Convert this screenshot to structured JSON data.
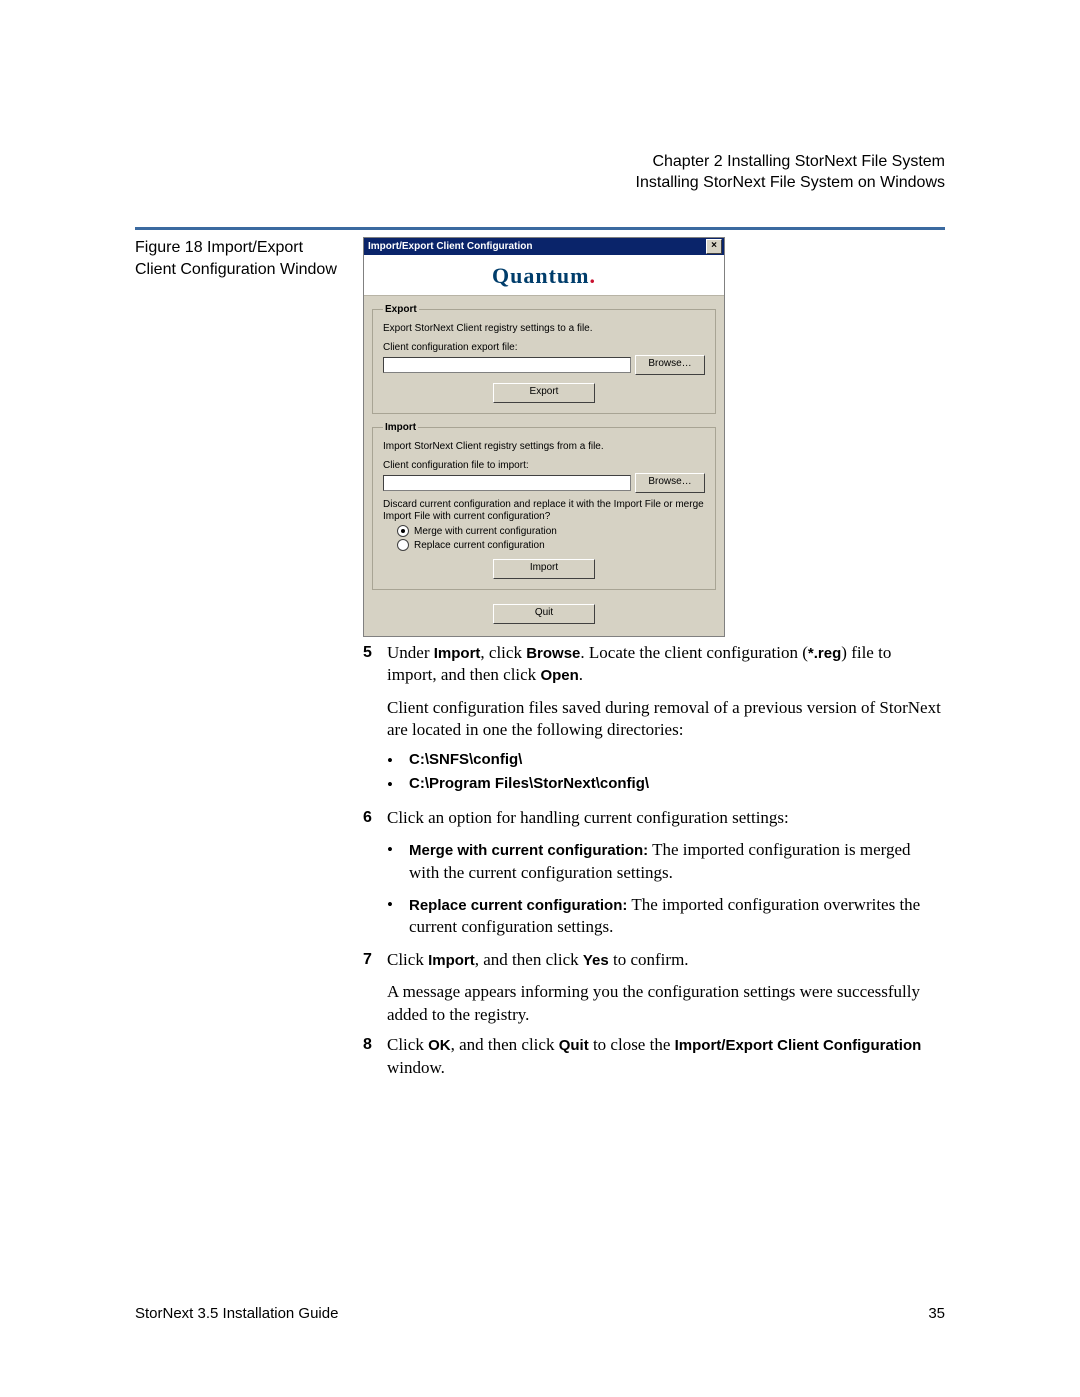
{
  "header": {
    "line1": "Chapter 2  Installing StorNext File System",
    "line2": "Installing StorNext File System on Windows"
  },
  "figure_caption": "Figure 18  Import/Export Client Configuration Window",
  "dialog": {
    "title": "Import/Export Client Configuration",
    "brand": "Quantum",
    "export": {
      "legend": "Export",
      "desc": "Export StorNext Client registry settings to a file.",
      "label": "Client configuration export file:",
      "browse": "Browse…",
      "action": "Export"
    },
    "import": {
      "legend": "Import",
      "desc": "Import StorNext Client registry settings from a file.",
      "label": "Client configuration file to import:",
      "browse": "Browse…",
      "question": "Discard current configuration and replace it with the Import File or merge Import File with current configuration?",
      "opt_merge": "Merge with current configuration",
      "opt_replace": "Replace current configuration",
      "action": "Import"
    },
    "quit": "Quit"
  },
  "steps": {
    "s5_pre": "Under ",
    "s5_b1": "Import",
    "s5_mid1": ", click ",
    "s5_b2": "Browse",
    "s5_mid2": ". Locate the client configuration (",
    "s5_b3": "*.reg",
    "s5_mid3": ") file to import, and then click ",
    "s5_b4": "Open",
    "s5_end": ".",
    "s5_para2": "Client configuration files saved during removal of a previous version of StorNext are located in one the following directories:",
    "path1": "C:\\SNFS\\config\\",
    "path2": "C:\\Program Files\\StorNext\\config\\",
    "s6": "Click an option for handling current configuration settings:",
    "s6_opt1_b": "Merge with current configuration:",
    "s6_opt1_t": " The imported configuration is merged with the current configuration settings.",
    "s6_opt2_b": "Replace current configuration:",
    "s6_opt2_t": " The imported configuration overwrites the current configuration settings.",
    "s7_pre": "Click ",
    "s7_b1": "Import",
    "s7_mid": ", and then click ",
    "s7_b2": "Yes",
    "s7_end": " to confirm.",
    "s7_para2": "A message appears informing you the configuration settings were successfully added to the registry.",
    "s8_pre": "Click ",
    "s8_b1": "OK",
    "s8_mid": ", and then click ",
    "s8_b2": "Quit",
    "s8_mid2": " to close the ",
    "s8_b3": "Import/Export Client Configuration",
    "s8_end": " window."
  },
  "footer": {
    "left": "StorNext 3.5 Installation Guide",
    "right": "35"
  }
}
